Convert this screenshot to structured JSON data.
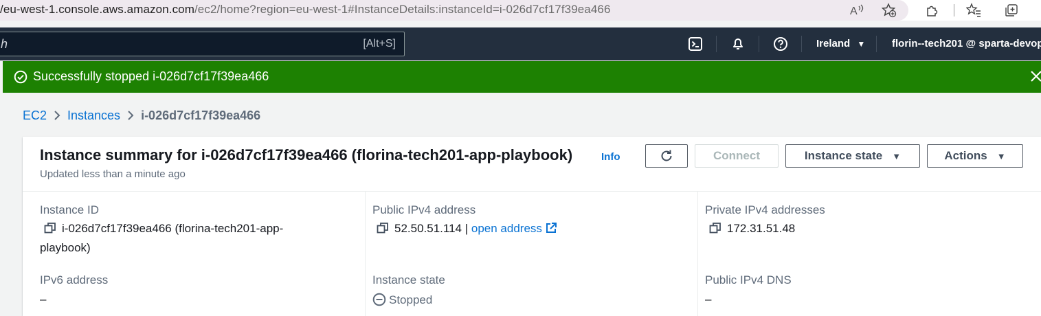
{
  "browser": {
    "url_host": "eu-west-1.console.aws.amazon.com",
    "url_path": "/ec2/home?region=eu-west-1#InstanceDetails:instanceId=i-026d7cf17f39ea466",
    "url_prefix": "/"
  },
  "nav": {
    "search_placeholder": "h",
    "search_shortcut": "[Alt+S]",
    "region": "Ireland",
    "account": "florin--tech201 @ sparta-devop"
  },
  "flash": {
    "message": "Successfully stopped i-026d7cf17f39ea466"
  },
  "breadcrumb": {
    "items": [
      "EC2",
      "Instances",
      "i-026d7cf17f39ea466"
    ]
  },
  "panel": {
    "title": "Instance summary for i-026d7cf17f39ea466 (florina-tech201-app-playbook)",
    "info": "Info",
    "subtitle": "Updated less than a minute ago",
    "buttons": {
      "connect": "Connect",
      "instance_state": "Instance state",
      "actions": "Actions"
    }
  },
  "details": {
    "instance_id": {
      "label": "Instance ID",
      "line1": "i-026d7cf17f39ea466 (florina-tech201-app-",
      "line2": "playbook)"
    },
    "public_ipv4": {
      "label": "Public IPv4 address",
      "value": "52.50.51.114 |",
      "link": "open address"
    },
    "private_ipv4": {
      "label": "Private IPv4 addresses",
      "value": "172.31.51.48"
    },
    "ipv6": {
      "label": "IPv6 address",
      "value": "–"
    },
    "instance_state": {
      "label": "Instance state",
      "value": "Stopped"
    },
    "public_dns": {
      "label": "Public IPv4 DNS",
      "value": "–"
    }
  },
  "colors": {
    "success": "#1d8102",
    "nav_bg": "#232f3e",
    "link": "#0972d3"
  }
}
